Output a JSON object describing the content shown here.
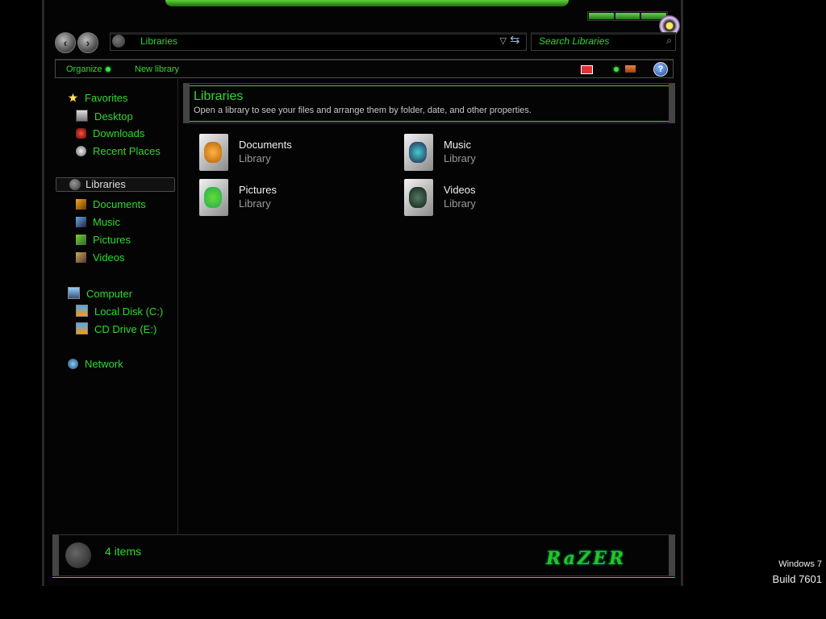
{
  "address_bar": {
    "location": "Libraries"
  },
  "search": {
    "placeholder": "Search Libraries"
  },
  "toolbar": {
    "organize": "Organize",
    "new_library": "New library",
    "help": "?"
  },
  "navigation": {
    "favorites": {
      "label": "Favorites",
      "items": [
        "Desktop",
        "Downloads",
        "Recent Places"
      ]
    },
    "libraries": {
      "label": "Libraries",
      "items": [
        "Documents",
        "Music",
        "Pictures",
        "Videos"
      ]
    },
    "computer": {
      "label": "Computer",
      "items": [
        "Local Disk (C:)",
        "CD Drive (E:)"
      ]
    },
    "network": {
      "label": "Network"
    }
  },
  "content": {
    "title": "Libraries",
    "subtitle": "Open a library to see your files and arrange them by folder, date, and other properties.",
    "libraries": [
      {
        "name": "Documents",
        "type": "Library"
      },
      {
        "name": "Music",
        "type": "Library"
      },
      {
        "name": "Pictures",
        "type": "Library"
      },
      {
        "name": "Videos",
        "type": "Library"
      }
    ]
  },
  "status": {
    "item_count": "4 items",
    "brand": "RaZER"
  },
  "watermark": {
    "os": "Windows 7",
    "build": "Build 7601"
  },
  "colors": {
    "accent": "#2fd92f",
    "background": "#000000"
  }
}
